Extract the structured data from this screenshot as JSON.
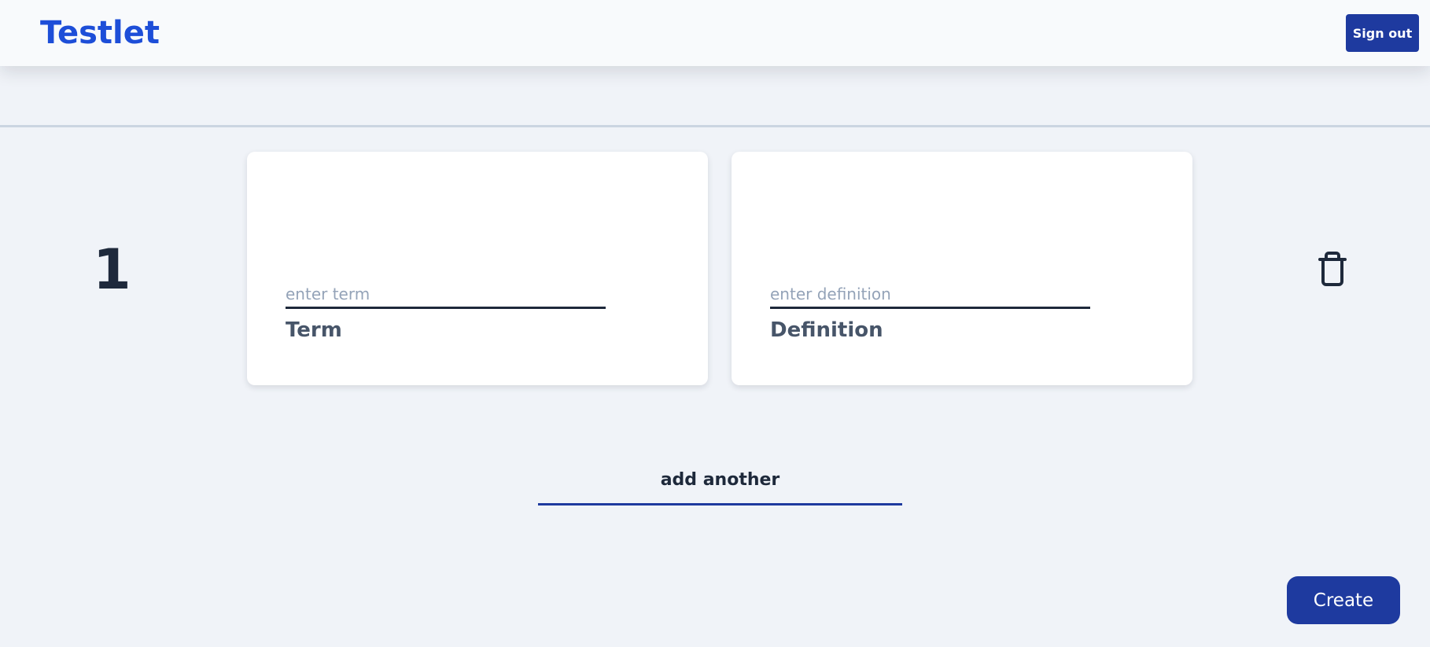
{
  "app": {
    "name": "Testlet"
  },
  "header": {
    "sign_out_label": "Sign out"
  },
  "cards": [
    {
      "number": "1",
      "term": {
        "value": "",
        "placeholder": "enter term",
        "label": "Term"
      },
      "definition": {
        "value": "",
        "placeholder": "enter definition",
        "label": "Definition"
      },
      "delete_icon": "trash-icon"
    }
  ],
  "actions": {
    "add_another_label": "add another",
    "create_label": "Create"
  },
  "colors": {
    "brand": "#1d4ed8",
    "button": "#1e3a9f",
    "background": "#f0f3f8",
    "text_dark": "#1e293b",
    "label_gray": "#475569",
    "placeholder_gray": "#94a3b8"
  }
}
